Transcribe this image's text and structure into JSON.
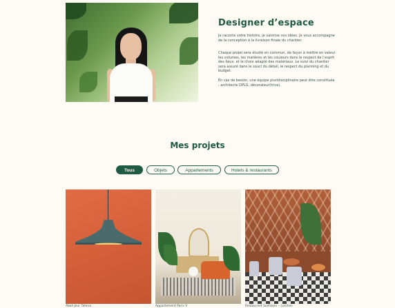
{
  "about": {
    "title": "Designer d’espace",
    "paragraphs": [
      "Je raconte votre histoire, je valorise vos idées. Je vous accompagne de la conception à la livraison finale du chantier.",
      "Chaque projet sera étudié en commun, de façon à mettre en valeur les volumes, les matières et les couleurs dans le respect de l’esprit des lieux, et le choix adapté des matériaux. Le suivi du chantier sera assuré dans le souci du détail, le respect du planning et du budget.",
      "En cas de besoin, une équipe pluridisciplinaire peut être constituée : architecte DPLG, décorateur(trice)."
    ]
  },
  "projects": {
    "title": "Mes projets",
    "filters": [
      {
        "label": "Tous",
        "active": true
      },
      {
        "label": "Objets",
        "active": false
      },
      {
        "label": "Appartements",
        "active": false
      },
      {
        "label": "Hotels & restaurants",
        "active": false
      }
    ],
    "cards": [
      {
        "label": "Abat-Jour Tahina"
      },
      {
        "label": "Appartement Paris V"
      },
      {
        "label": "Restaurant Sushiken – Lorches"
      }
    ]
  },
  "colors": {
    "accent": "#1f5a45",
    "background": "#fdfbf3"
  }
}
